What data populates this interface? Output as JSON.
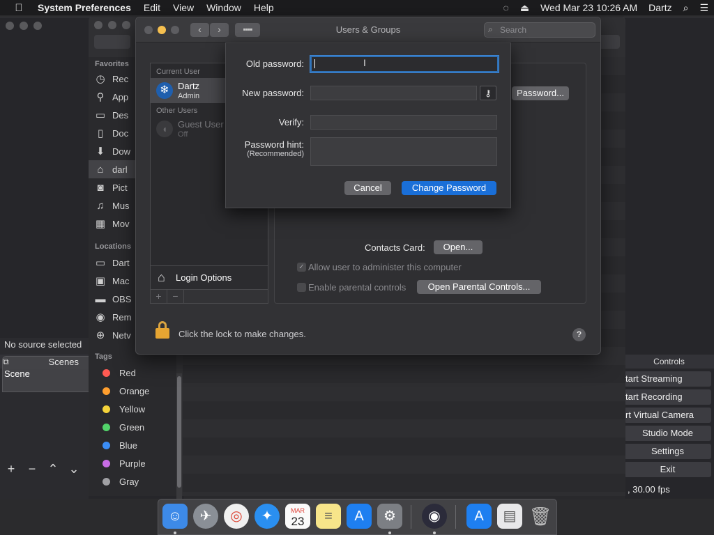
{
  "menubar": {
    "apple": "",
    "app_name": "System Preferences",
    "menus": [
      "Edit",
      "View",
      "Window",
      "Help"
    ],
    "date_time": "Wed Mar 23  10:26 AM",
    "user": "Dartz"
  },
  "obs": {
    "no_source": "No source selected",
    "scenes_label": "Scenes",
    "scene_item": "Scene",
    "controls_label": "Controls",
    "controls": [
      "tart Streaming",
      "tart Recording",
      "rt Virtual Camera",
      "Studio Mode",
      "Settings",
      "Exit"
    ],
    "status": ", 30.00 fps"
  },
  "finder": {
    "favorites_header": "Favorites",
    "favorites": [
      "Rec",
      "App",
      "Des",
      "Doc",
      "Dow",
      "darl",
      "Pict",
      "Mus",
      "Mov"
    ],
    "locations_header": "Locations",
    "locations": [
      "Dart",
      "Mac",
      "OBS",
      "Rem",
      "Netv"
    ],
    "tags_header": "Tags",
    "tags": [
      {
        "name": "Red",
        "color": "#ff5a52"
      },
      {
        "name": "Orange",
        "color": "#ff9f2e"
      },
      {
        "name": "Yellow",
        "color": "#f5d33a"
      },
      {
        "name": "Green",
        "color": "#52d36a"
      },
      {
        "name": "Blue",
        "color": "#3b8df5"
      },
      {
        "name": "Purple",
        "color": "#c86de6"
      },
      {
        "name": "Gray",
        "color": "#a0a0a4"
      }
    ]
  },
  "window": {
    "title": "Users & Groups",
    "search_placeholder": "Search",
    "back": "‹",
    "forward": "›",
    "grid": "▪▪▪▪"
  },
  "users": {
    "current_header": "Current User",
    "current": {
      "name": "Dartz",
      "role": "Admin"
    },
    "other_header": "Other Users",
    "other": {
      "name": "Guest User",
      "role": "Off"
    },
    "login_options": "Login Options",
    "add": "+",
    "remove": "−"
  },
  "detail": {
    "change_password_btn": "Password...",
    "contacts_label": "Contacts Card:",
    "contacts_btn": "Open...",
    "allow_admin": "Allow user to administer this computer",
    "parental": "Enable parental controls",
    "parental_btn": "Open Parental Controls..."
  },
  "lock_text": "Click the lock to make changes.",
  "help": "?",
  "sheet": {
    "old_password_label": "Old password:",
    "old_password_value": "",
    "new_password_label": "New password:",
    "new_password_value": "",
    "verify_label": "Verify:",
    "verify_value": "",
    "hint_label": "Password hint:",
    "hint_sub": "(Recommended)",
    "hint_value": "",
    "cancel": "Cancel",
    "change": "Change Password"
  },
  "dock": {
    "calendar_month": "MAR",
    "calendar_day": "23"
  }
}
